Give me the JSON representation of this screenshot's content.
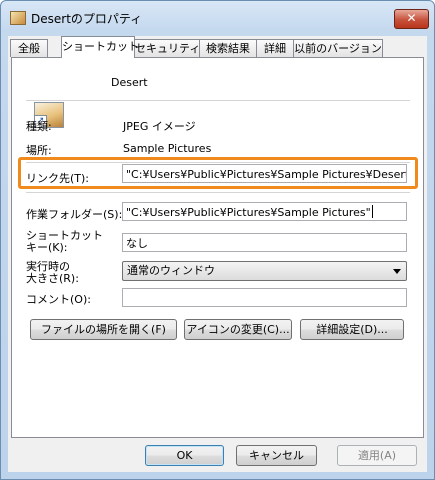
{
  "window": {
    "title": "Desertのプロパティ",
    "close_glyph": "✕"
  },
  "tabs": [
    {
      "label": "全般"
    },
    {
      "label": "ショートカット"
    },
    {
      "label": "セキュリティ"
    },
    {
      "label": "検索結果"
    },
    {
      "label": "詳細"
    },
    {
      "label": "以前のバージョン"
    }
  ],
  "active_tab": "ショートカット",
  "file": {
    "name": "Desert",
    "icon": "jpeg-shortcut-icon"
  },
  "info": {
    "type_label": "種類:",
    "type_value": "JPEG イメージ",
    "location_label": "場所:",
    "location_value": "Sample Pictures"
  },
  "fields": {
    "target_label": "リンク先(T):",
    "target_value": "\"C:¥Users¥Public¥Pictures¥Sample Pictures¥Desert.jp",
    "workdir_label": "作業フォルダー(S):",
    "workdir_value": "\"C:¥Users¥Public¥Pictures¥Sample Pictures\"",
    "shortcut_label_1": "ショートカット",
    "shortcut_label_2": "キー(K):",
    "shortcut_value": "なし",
    "run_label_1": "実行時の",
    "run_label_2": "大きさ(R):",
    "run_value": "通常のウィンドウ",
    "comment_label": "コメント(O):",
    "comment_value": ""
  },
  "action_buttons": {
    "open_location": "ファイルの場所を開く(F)",
    "change_icon": "アイコンの変更(C)...",
    "advanced": "詳細設定(D)..."
  },
  "footer_buttons": {
    "ok": "OK",
    "cancel": "キャンセル",
    "apply": "適用(A)"
  },
  "colors": {
    "highlight": "#f08a1c",
    "titlebar": "#c4d8ee",
    "close": "#c7513b"
  }
}
